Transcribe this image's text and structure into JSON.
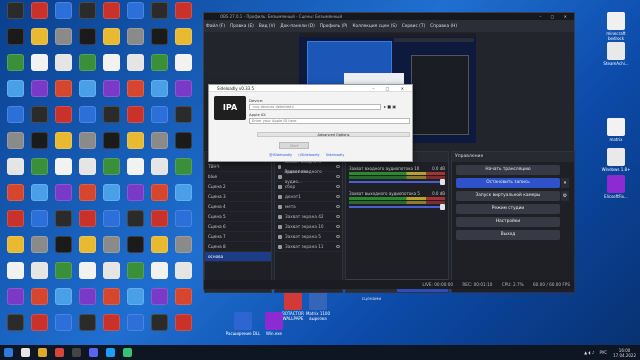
{
  "obs": {
    "title": "OBS 27.0.1 - Профиль: Безымянный - Сцены: Безымянный",
    "menu": [
      "Файл (F)",
      "Правка (E)",
      "Вид (V)",
      "Док-панели (D)",
      "Профиль (P)",
      "Коллекция сцен (S)",
      "Сервис (T)",
      "Справка (H)"
    ],
    "scenes_header": "Сцены",
    "scenes": [
      "ТВНЧ",
      "blue",
      "Сцена 2",
      "Сцена 3",
      "Сцена 4",
      "Сцена 5",
      "Сцена 6",
      "Сцена 7",
      "Сцена 8",
      "основа"
    ],
    "sources_header": "Источники",
    "sources": [
      "Захват входного аудиопото",
      "Захват входного аудио...",
      "сбор",
      "донат1",
      "мета",
      "Захват экрана 42",
      "Захват экрана 10",
      "Захват экрана 5",
      "Захват экрана 11"
    ],
    "mixer_header": "Микшер аудио",
    "mixer": [
      {
        "name": "Захват входного аудиопотока 10",
        "db": "0.0 dB"
      },
      {
        "name": "Захват выходного аудиопотока 5",
        "db": "0.0 dB"
      }
    ],
    "mixer_tabs": [
      "Переходы между сценами",
      "Микшер звука"
    ],
    "controls_header": "Управление",
    "controls": [
      "Начать трансляцию",
      "Остановить запись",
      "Запуск виртуальной камеры",
      "Режим студии",
      "Настройки",
      "Выход"
    ],
    "status": [
      "LIVE: 00:00:00",
      "REC: 00:01:10",
      "CPU: 2.7%",
      "60.00 / 60.00 FPS"
    ]
  },
  "sideloadly": {
    "title": "Sideloadly v0.33.5",
    "ipa_label": "IPA",
    "device_label": "Device:",
    "device_value": "<no devices detected>",
    "appleid_label": "Apple ID:",
    "appleid_placeholder": "Enter your Apple ID here",
    "advanced": "Advanced Options",
    "start": "Start",
    "social": [
      "@iSideloadly",
      "r/Sideloadly",
      "Sideloadly"
    ]
  },
  "desktop": {
    "right_icons": [
      "minecraft bedrock",
      "SteamAchi...",
      "matrix",
      "вырезка",
      "Windows 1.8+",
      "ElicsoftFix..."
    ],
    "bottom_icons": [
      "BOTACTOR WALLPAPE",
      "Matrix 1100 вырезка",
      "Расширение DLL",
      "Win.exe"
    ]
  },
  "taskbar": {
    "lang": "РУС",
    "time": "16:00",
    "date": "17.04.2022"
  },
  "colors": {
    "desktop_bg": "#1f6fd1",
    "obs_bg": "#22252c",
    "obs_accent": "#2f4db3",
    "taskbar_bg": "#0e1624"
  }
}
